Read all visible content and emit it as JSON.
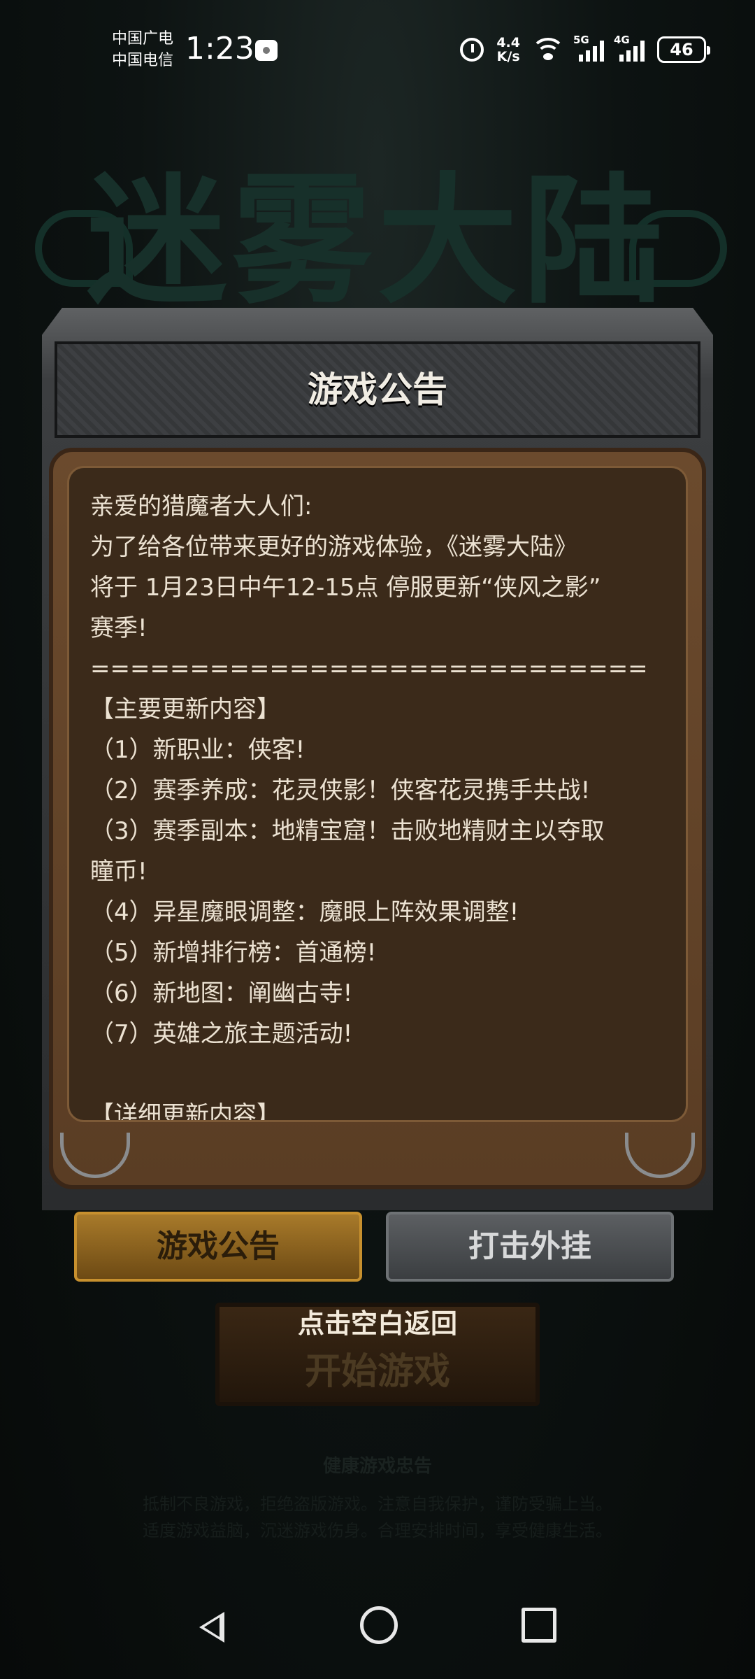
{
  "status_bar": {
    "carrier_1": "中国广电",
    "carrier_2": "中国电信",
    "time": "1:23",
    "net_speed_value": "4.4",
    "net_speed_unit": "K/s",
    "signal_1_label": "5G",
    "signal_2_label": "4G",
    "battery": "46",
    "icons": [
      "alarm-icon",
      "wifi-icon",
      "signal-5g-icon",
      "signal-4g-icon",
      "battery-icon"
    ]
  },
  "background": {
    "game_logo": "迷雾大陆",
    "buttons": {
      "notice": "游戏公告",
      "anti_cheat": "打击外挂",
      "start": "开始游戏"
    },
    "health_title": "健康游戏忠告",
    "health_lines": [
      "抵制不良游戏，拒绝盗版游戏。注意自我保护，谨防受骗上当。",
      "适度游戏益脑，沉迷游戏伤身。合理安排时间，享受健康生活。"
    ]
  },
  "modal": {
    "title": "游戏公告",
    "lines": [
      "亲爱的猎魔者大人们:",
      "为了给各位带来更好的游戏体验，《迷雾大陆》",
      "将于 1月23日中午12-15点 停服更新“侠风之影”",
      "赛季!",
      "============================",
      "【主要更新内容】",
      "（1）新职业：侠客!",
      "（2）赛季养成：花灵侠影！侠客花灵携手共战!",
      "（3）赛季副本：地精宝窟！击败地精财主以夺取",
      "瞳币!",
      "（4）异星魔眼调整：魔眼上阵效果调整!",
      "（5）新增排行榜：首通榜!",
      "（6）新地图：阐幽古寺!",
      "（7）英雄之旅主题活动!",
      "",
      "【详细更新内容】"
    ],
    "tap_to_return": "点击空白返回"
  },
  "nav_bar": {
    "icons": [
      "back-icon",
      "home-icon",
      "recent-apps-icon"
    ]
  }
}
